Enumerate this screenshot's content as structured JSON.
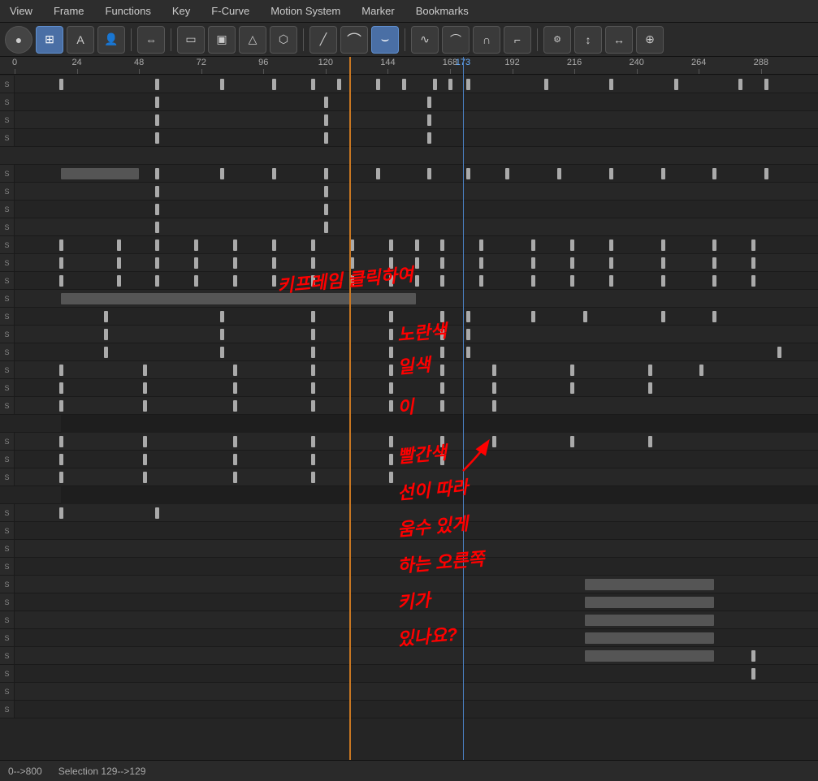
{
  "menubar": {
    "items": [
      "View",
      "Frame",
      "Functions",
      "Key",
      "F-Curve",
      "Motion System",
      "Marker",
      "Bookmarks"
    ]
  },
  "toolbar": {
    "tools": [
      {
        "id": "circle",
        "icon": "●",
        "active": false
      },
      {
        "id": "frame",
        "icon": "⊞",
        "active": true
      },
      {
        "id": "text",
        "icon": "A",
        "active": false
      },
      {
        "id": "person",
        "icon": "👤",
        "active": false
      },
      {
        "id": "sep1",
        "type": "separator"
      },
      {
        "id": "move",
        "icon": "⇔",
        "active": false
      },
      {
        "id": "sep2",
        "type": "separator"
      },
      {
        "id": "rect",
        "icon": "▭",
        "active": false
      },
      {
        "id": "box1",
        "icon": "▣",
        "active": false
      },
      {
        "id": "box2",
        "icon": "△",
        "active": false
      },
      {
        "id": "box3",
        "icon": "⬡",
        "active": false
      },
      {
        "id": "sep3",
        "type": "separator"
      },
      {
        "id": "line1",
        "icon": "╱",
        "active": false
      },
      {
        "id": "line2",
        "icon": "⌒",
        "active": false
      },
      {
        "id": "line3",
        "icon": "⌣",
        "active": true
      },
      {
        "id": "sep4",
        "type": "separator"
      },
      {
        "id": "curve1",
        "icon": "∿",
        "active": false
      },
      {
        "id": "curve2",
        "icon": "⌒",
        "active": false
      },
      {
        "id": "curve3",
        "icon": "∩",
        "active": false
      },
      {
        "id": "curve4",
        "icon": "⌐",
        "active": false
      },
      {
        "id": "sep5",
        "type": "separator"
      },
      {
        "id": "handle1",
        "icon": "⚙",
        "active": false
      },
      {
        "id": "handle2",
        "icon": "↕",
        "active": false
      },
      {
        "id": "handle3",
        "icon": "↔",
        "active": false
      },
      {
        "id": "handle4",
        "icon": "⊕",
        "active": false
      }
    ]
  },
  "ruler": {
    "marks": [
      0,
      24,
      48,
      72,
      96,
      120,
      144,
      168,
      173,
      192,
      216,
      240,
      264,
      288
    ],
    "highlight": 173
  },
  "playheads": {
    "orange_frame": 129,
    "blue_frame": 173
  },
  "annotation": {
    "text": "키프레임 클릭하여\n노란색\n일색\n이\n빨간색\n선이 따라\n움수 있게\n하는 오른쪽\n키가\n있나요?"
  },
  "statusbar": {
    "range": "0-->800",
    "selection": "Selection 129-->129"
  },
  "tracks": {
    "count": 32,
    "rows": []
  }
}
